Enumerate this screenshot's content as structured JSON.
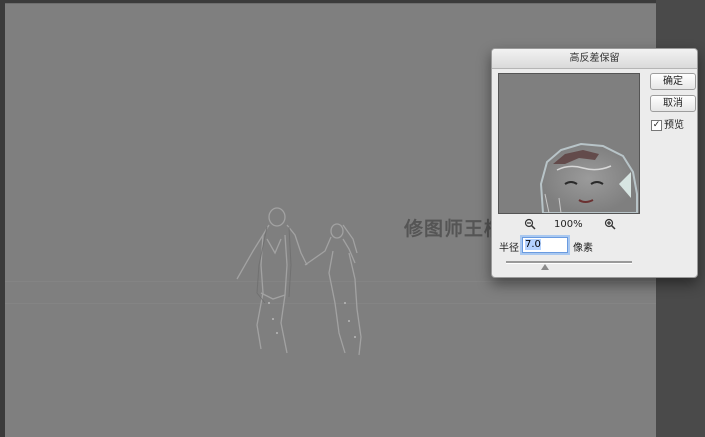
{
  "dialog": {
    "title": "高反差保留",
    "ok_label": "确定",
    "cancel_label": "取消",
    "preview_label": "预览",
    "preview_checked": true,
    "zoom_value": "100%",
    "radius_label": "半径:",
    "radius_value": "7.0",
    "radius_unit": "像素"
  },
  "canvas": {
    "watermark": "修图师王楠作品"
  },
  "colors": {
    "canvas_gray": "#7f7f7f",
    "workspace": "#3b3b3b",
    "dialog_bg": "#ececec",
    "focus_ring": "#a9c8f0"
  },
  "icons": [
    "zoom-out-icon",
    "zoom-in-icon",
    "checkmark-icon"
  ]
}
